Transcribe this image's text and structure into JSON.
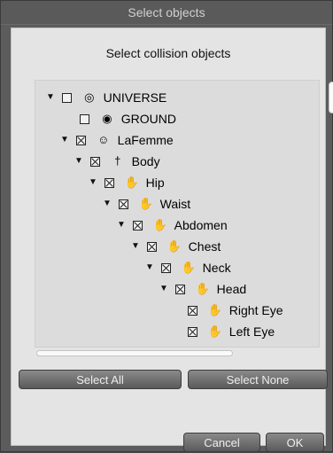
{
  "window": {
    "title": "Select objects"
  },
  "panel": {
    "heading": "Select collision objects"
  },
  "tree": [
    {
      "label": "UNIVERSE",
      "expanded": true,
      "checked": false,
      "icon": "globe-icon"
    },
    {
      "label": "GROUND",
      "expanded": false,
      "checked": false,
      "icon": "ground-icon"
    },
    {
      "label": "LaFemme",
      "expanded": true,
      "checked": true,
      "icon": "figure-icon"
    },
    {
      "label": "Body",
      "expanded": true,
      "checked": true,
      "icon": "body-icon"
    },
    {
      "label": "Hip",
      "expanded": true,
      "checked": true,
      "icon": "hand-icon"
    },
    {
      "label": "Waist",
      "expanded": true,
      "checked": true,
      "icon": "hand-icon"
    },
    {
      "label": "Abdomen",
      "expanded": true,
      "checked": true,
      "icon": "hand-icon"
    },
    {
      "label": "Chest",
      "expanded": true,
      "checked": true,
      "icon": "hand-icon"
    },
    {
      "label": "Neck",
      "expanded": true,
      "checked": true,
      "icon": "hand-icon"
    },
    {
      "label": "Head",
      "expanded": true,
      "checked": true,
      "icon": "hand-icon"
    },
    {
      "label": "Right Eye",
      "expanded": false,
      "checked": true,
      "icon": "hand-icon"
    },
    {
      "label": "Left Eye",
      "expanded": false,
      "checked": true,
      "icon": "hand-icon"
    }
  ],
  "buttons": {
    "select_all": "Select All",
    "select_none": "Select None",
    "cancel": "Cancel",
    "ok": "OK"
  }
}
